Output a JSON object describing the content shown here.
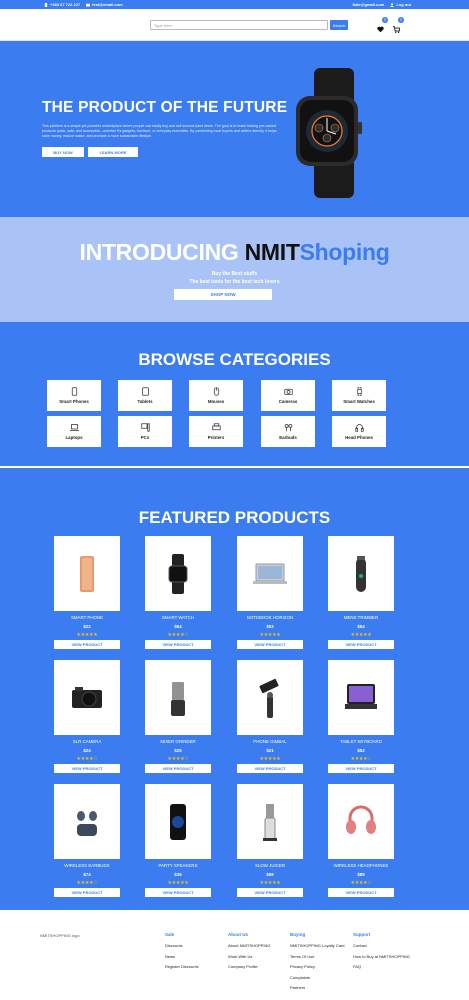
{
  "topbar": {
    "phone": "+383 67 722 227",
    "email": "test@email.com",
    "sale_email": "Sale@gmail.com",
    "logout": "Log out"
  },
  "header": {
    "search_placeholder": "Type here",
    "search_button": "Search",
    "wishlist_count": "0",
    "cart_count": "0"
  },
  "hero": {
    "title": "THE PRODUCT OF THE FUTURE",
    "text": "This platform is a simple yet powerful marketplace where people can easily buy and sell second-hand items. The goal is to make trading pre-owned products quick, safe, and accessible—whether it's gadgets, furniture, or everyday essentials. By connecting local buyers and sellers directly, it helps save money, reduce waste, and promote a more sustainable lifestyle.",
    "buy_now": "BUY NOW",
    "learn_more": "LEARN MORE"
  },
  "intro": {
    "word1": "INTRODUCING ",
    "word2": "NMIT",
    "word3": "Shoping",
    "line1": "Buy the Best stuffs",
    "line2": "The best tools for the best tech lovers",
    "button": "SHOP NOW"
  },
  "categories": {
    "title": "BROWSE CATEGORIES",
    "items": [
      {
        "label": "Smart Phones",
        "icon": "phone-icon"
      },
      {
        "label": "Tablets",
        "icon": "tablet-icon"
      },
      {
        "label": "Mouses",
        "icon": "mouse-icon"
      },
      {
        "label": "Cameras",
        "icon": "camera-icon"
      },
      {
        "label": "Smart Watches",
        "icon": "watch-icon"
      },
      {
        "label": "Laptops",
        "icon": "laptop-icon"
      },
      {
        "label": "PCs",
        "icon": "pc-icon"
      },
      {
        "label": "Printers",
        "icon": "printer-icon"
      },
      {
        "label": "Earbuds",
        "icon": "earbuds-icon"
      },
      {
        "label": "Head Phones",
        "icon": "headphones-icon"
      }
    ]
  },
  "featured": {
    "title": "FEATURED PRODUCTS",
    "button_label": "VIEW PRODUCT",
    "items": [
      {
        "name": "SMART PHONE",
        "price": "$22",
        "rating": 5,
        "stars": "★★★★★",
        "icon": "smartphone-product-image"
      },
      {
        "name": "SMART WATCH",
        "price": "$64",
        "rating": 4,
        "stars": "★★★★☆",
        "icon": "smartwatch-product-image"
      },
      {
        "name": "NOTEBOOK HORIZON",
        "price": "$52",
        "rating": 5,
        "stars": "★★★★★",
        "icon": "notebook-product-image"
      },
      {
        "name": "MENS TRIMMER",
        "price": "$54",
        "rating": 5,
        "stars": "★★★★★",
        "icon": "trimmer-product-image"
      },
      {
        "name": "SLR CAMERA",
        "price": "$24",
        "rating": 4,
        "stars": "★★★★☆",
        "icon": "camera-product-image"
      },
      {
        "name": "MIXER GRINDER",
        "price": "$25",
        "rating": 4,
        "stars": "★★★★☆",
        "icon": "mixer-product-image"
      },
      {
        "name": "PHONE GIMBAL",
        "price": "$21",
        "rating": 5,
        "stars": "★★★★★",
        "icon": "gimbal-product-image"
      },
      {
        "name": "TABLET KEYBOARD",
        "price": "$52",
        "rating": 4,
        "stars": "★★★★☆",
        "icon": "tablet-keyboard-product-image"
      },
      {
        "name": "WIRELESS EARBUDS",
        "price": "$74",
        "rating": 4,
        "stars": "★★★★☆",
        "icon": "earbuds-product-image"
      },
      {
        "name": "PARTY SPEAKERS",
        "price": "$35",
        "rating": 5,
        "stars": "★★★★★",
        "icon": "speaker-product-image"
      },
      {
        "name": "SLOW JUICER",
        "price": "$69",
        "rating": 5,
        "stars": "★★★★★",
        "icon": "juicer-product-image"
      },
      {
        "name": "WIRELESS HEADPHONES",
        "price": "$89",
        "rating": 4,
        "stars": "★★★★☆",
        "icon": "headphones-product-image"
      }
    ]
  },
  "footer": {
    "logo_alt": "NMITSHOPPING logo",
    "columns": [
      {
        "title": "Sale",
        "links": [
          "Discounts",
          "News",
          "Register Discounts"
        ]
      },
      {
        "title": "About Us",
        "links": [
          "About NMITSHOPPING",
          "Work With Us",
          "Company Profile"
        ]
      },
      {
        "title": "Buying",
        "links": [
          "NMITSHOPPING Loyalty Card",
          "Terms Of Use",
          "Privacy Policy",
          "Complaints",
          "Partners"
        ]
      },
      {
        "title": "Support",
        "links": [
          "Contact",
          "How to Buy at NMITSHOPPING",
          "FAQ"
        ]
      }
    ]
  },
  "colors": {
    "brand": "#3b7cf0",
    "light_brand": "#a9c3f6",
    "star": "#f4c20d"
  }
}
